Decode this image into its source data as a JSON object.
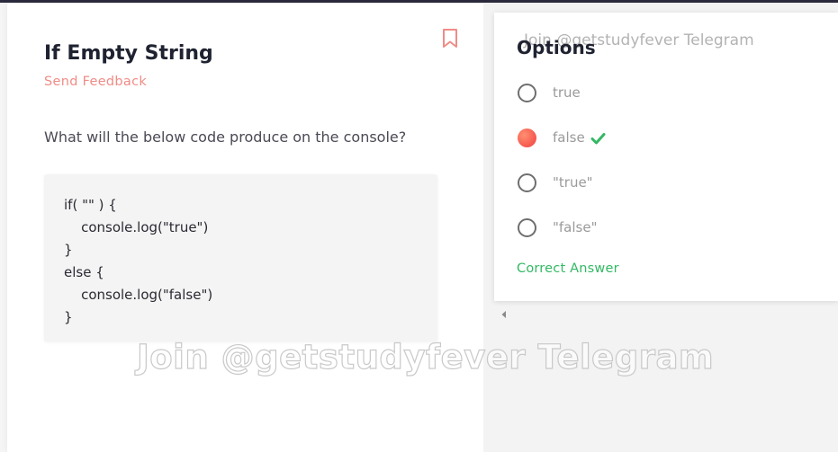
{
  "question": {
    "title": "If Empty String",
    "feedback_label": "Send Feedback",
    "prompt": "What will the below code produce on the console?",
    "code_lines": [
      "if( \"\" ) {",
      "    console.log(\"true\")",
      "}",
      "else {",
      "    console.log(\"false\")",
      "}"
    ]
  },
  "options_panel": {
    "watermark": "Join @getstudyfever Telegram",
    "title": "Options",
    "options": [
      {
        "label": "true",
        "selected": false,
        "correct": false
      },
      {
        "label": "false",
        "selected": true,
        "correct": true
      },
      {
        "label": "\"true\"",
        "selected": false,
        "correct": false
      },
      {
        "label": "\"false\"",
        "selected": false,
        "correct": false
      }
    ],
    "result_label": "Correct Answer"
  },
  "watermark": "Join @getstudyfever Telegram",
  "icons": {
    "bookmark": "bookmark-icon",
    "check": "checkmark-icon",
    "scroll_left": "scroll-left-arrow-icon"
  },
  "colors": {
    "accent": "#f08c86",
    "correct": "#33b864",
    "selected_radio": "#f5574f"
  }
}
